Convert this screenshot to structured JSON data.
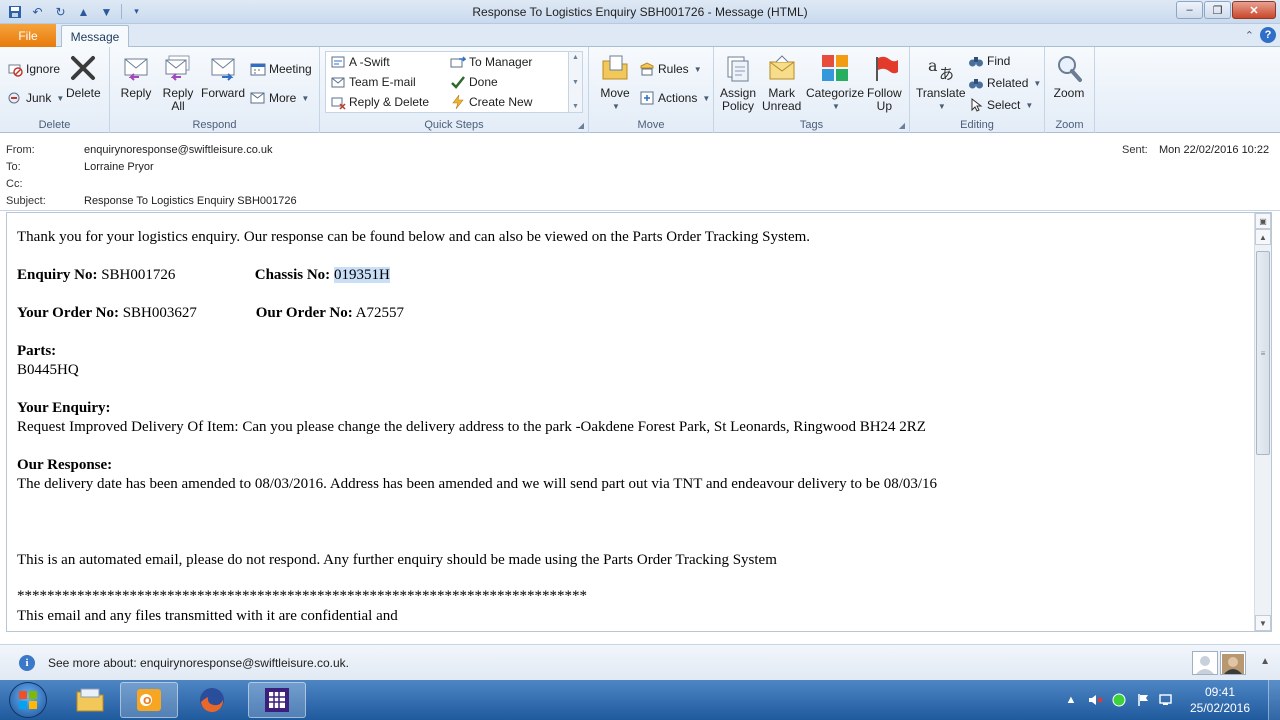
{
  "window": {
    "title": "Response To Logistics Enquiry SBH001726  -  Message (HTML)"
  },
  "tabs": {
    "file": "File",
    "message": "Message"
  },
  "ribbon": {
    "delete_group": {
      "label": "Delete",
      "ignore": "Ignore",
      "junk": "Junk",
      "delete": "Delete"
    },
    "respond_group": {
      "label": "Respond",
      "reply": "Reply",
      "reply_all_1": "Reply",
      "reply_all_2": "All",
      "forward": "Forward",
      "meeting": "Meeting",
      "more": "More"
    },
    "quick_steps_group": {
      "label": "Quick Steps",
      "items": [
        "A -Swift",
        "To Manager",
        "Team E-mail",
        "Done",
        "Reply & Delete",
        "Create New"
      ]
    },
    "move_group": {
      "label": "Move",
      "move": "Move",
      "rules": "Rules",
      "actions": "Actions"
    },
    "tags_group": {
      "label": "Tags",
      "assign_policy_1": "Assign",
      "assign_policy_2": "Policy",
      "mark_unread_1": "Mark",
      "mark_unread_2": "Unread",
      "categorize": "Categorize",
      "follow_up_1": "Follow",
      "follow_up_2": "Up"
    },
    "editing_group": {
      "label": "Editing",
      "translate": "Translate",
      "find": "Find",
      "related": "Related",
      "select": "Select"
    },
    "zoom_group": {
      "label": "Zoom",
      "zoom": "Zoom"
    }
  },
  "header": {
    "from_label": "From:",
    "from_value": "enquirynoresponse@swiftleisure.co.uk",
    "to_label": "To:",
    "to_value": "Lorraine Pryor",
    "cc_label": "Cc:",
    "subject_label": "Subject:",
    "subject_value": "Response To Logistics Enquiry SBH001726",
    "sent_label": "Sent:",
    "sent_value": "Mon 22/02/2016 10:22"
  },
  "body": {
    "intro": "Thank you for your logistics enquiry. Our response can be found below and can also be viewed on the Parts Order Tracking System.",
    "enquiry_no_label": "Enquiry No:",
    "enquiry_no_value": "SBH001726",
    "chassis_no_label": "Chassis No:",
    "chassis_no_value": "019351H",
    "your_order_label": "Your Order No:",
    "your_order_value": "SBH003627",
    "our_order_label": "Our Order No:",
    "our_order_value": "A72557",
    "parts_label": "Parts:",
    "parts_value": "B0445HQ",
    "your_enquiry_label": "Your Enquiry:",
    "your_enquiry_value": "Request Improved Delivery Of Item: Can you please change the delivery address to the park -Oakdene Forest Park, St Leonards, Ringwood BH24 2RZ",
    "our_response_label": "Our Response:",
    "our_response_value": "The delivery date has been amended to 08/03/2016. Address has been amended and we will send part out via TNT and endeavour delivery to be 08/03/16",
    "automated_notice": "This is an automated email, please do not respond. Any further enquiry should be made using the Parts Order Tracking System",
    "asterisks": "****************************************************************************",
    "confidential": "This email and any files transmitted with it are confidential and"
  },
  "people_pane": {
    "see_more": "See more about: enquirynoresponse@swiftleisure.co.uk."
  },
  "taskbar": {
    "time": "09:41",
    "date": "25/02/2016"
  },
  "colors": {
    "file_tab": "#e87a0b",
    "highlight": "#c9dff7",
    "taskbar": "#1f5a9e"
  }
}
